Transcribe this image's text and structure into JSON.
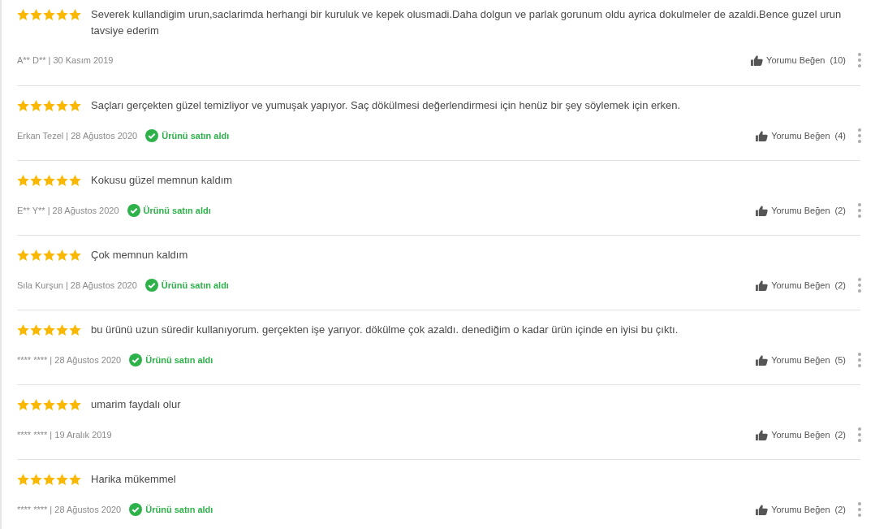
{
  "reviews": [
    {
      "stars": 5,
      "text": "Severek kullandigim urun,saclarimda herhangi bir kuruluk ve kepek olusmadi.Daha dolgun ve parlak gorunum oldu ayrica dokulmeler de azaldi.Bence guzel urun tavsiye ederim",
      "meta": "A** D** | 30 Kasım 2019",
      "purchased": false,
      "like_label": "Yorumu Beğen",
      "like_count": "(10)"
    },
    {
      "stars": 5,
      "text": "Saçları gerçekten güzel temizliyor ve yumuşak yapıyor. Saç dökülmesi değerlendirmesi için henüz bir şey söylemek için erken.",
      "meta": "Erkan Tezel | 28 Ağustos 2020",
      "purchased": true,
      "purchase_label": "Ürünü satın aldı",
      "like_label": "Yorumu Beğen",
      "like_count": "(4)"
    },
    {
      "stars": 5,
      "text": "Kokusu güzel memnun kaldım",
      "meta": "E** Y** | 28 Ağustos 2020",
      "purchased": true,
      "purchase_label": "Ürünü satın aldı",
      "like_label": "Yorumu Beğen",
      "like_count": "(2)"
    },
    {
      "stars": 5,
      "text": "Çok memnun kaldım",
      "meta": "Sıla Kurşun | 28 Ağustos 2020",
      "purchased": true,
      "purchase_label": "Ürünü satın aldı",
      "like_label": "Yorumu Beğen",
      "like_count": "(2)"
    },
    {
      "stars": 5,
      "text": "bu ürünü uzun süredir kullanıyorum. gerçekten işe yarıyor. dökülme çok azaldı. denediğim o kadar ürün içinde en iyisi bu çıktı.",
      "meta": "**** **** | 28 Ağustos 2020",
      "purchased": true,
      "purchase_label": "Ürünü satın aldı",
      "like_label": "Yorumu Beğen",
      "like_count": "(5)"
    },
    {
      "stars": 5,
      "text": "umarim faydalı olur",
      "meta": "**** **** | 19 Aralık 2019",
      "purchased": false,
      "like_label": "Yorumu Beğen",
      "like_count": "(2)"
    },
    {
      "stars": 5,
      "text": "Harika mükemmel",
      "meta": "**** **** | 28 Ağustos 2020",
      "purchased": true,
      "purchase_label": "Ürünü satın aldı",
      "like_label": "Yorumu Beğen",
      "like_count": "(2)"
    }
  ]
}
